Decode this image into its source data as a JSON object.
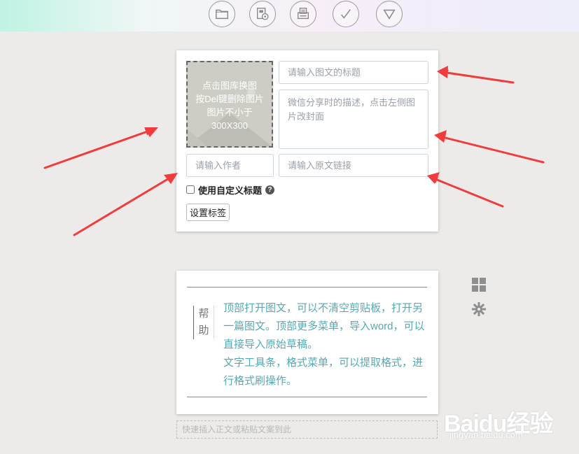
{
  "toolbar": {
    "buttons": [
      {
        "name": "folder-icon"
      },
      {
        "name": "picture-gallery-icon"
      },
      {
        "name": "printer-icon"
      },
      {
        "name": "checkmark-icon"
      },
      {
        "name": "dropdown-triangle-icon"
      }
    ]
  },
  "editor": {
    "cover_hint": [
      "点击图库换图",
      "按Del键删除图片",
      "图片不小于",
      "300X300"
    ],
    "title_placeholder": "请输入图文的标题",
    "description_placeholder": "微信分享时的描述，点击左侧图片改封面",
    "author_placeholder": "请输入作者",
    "source_link_placeholder": "请输入原文链接",
    "custom_title_label": "使用自定义标题",
    "help_glyph": "?",
    "set_tags_label": "设置标签"
  },
  "help": {
    "label_line1": "帮",
    "label_line2": "助",
    "paragraph1": "顶部打开图文，可以不清空剪贴板，打开另一篇图文。顶部更多菜单，导入word，可以直接导入原始草稿。",
    "paragraph2": "文字工具条，格式菜单，可以提取格式，进行格式刷操作。"
  },
  "paste_area": {
    "text": "快速插入正文或粘贴文案到此"
  },
  "side_icons": [
    "grid-layout-icon",
    "gear-icon"
  ],
  "watermark": {
    "logo": "Baidu经验",
    "url": "jingyan.baidu.com"
  },
  "colors": {
    "annotation_arrow": "#f03c3c",
    "help_text": "#53aab5",
    "background": "#ecebe9"
  }
}
